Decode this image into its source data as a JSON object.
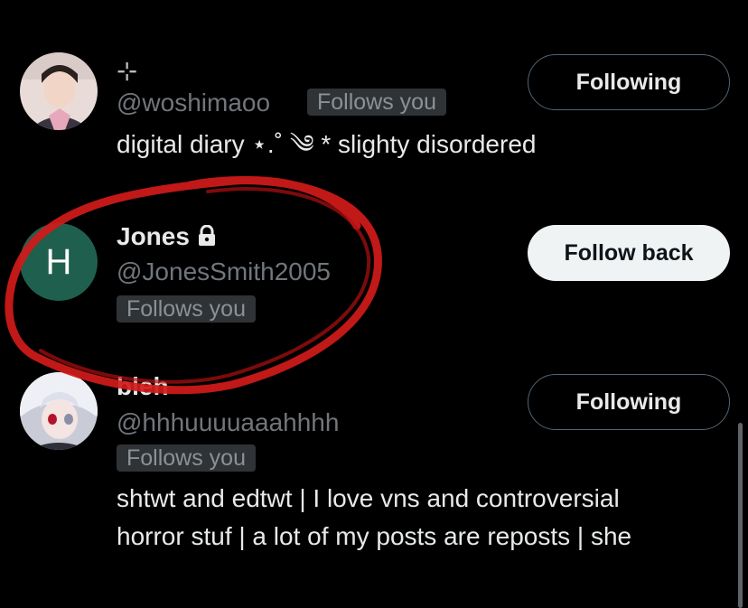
{
  "users": [
    {
      "name": "⊹",
      "handle": "@woshimaoo",
      "follows_you": "Follows you",
      "bio_lines": [
        "digital diary ⋆.˚ ༄ * slighty disordered"
      ],
      "button": "Following",
      "avatar": "photo-avatar"
    },
    {
      "name": "Jones",
      "handle": "@JonesSmith2005",
      "follows_you": "Follows you",
      "bio_lines": [],
      "button": "Follow back",
      "avatar_letter": "H",
      "avatar_color": "#1f5f4d",
      "locked": true
    },
    {
      "name": "bleh",
      "handle": "@hhhuuuuaaahhhh",
      "follows_you": "Follows you",
      "bio_lines": [
        "shtwt and edtwt | I love vns and controversial",
        "horror stuf | a lot of my posts are reposts | she"
      ],
      "button": "Following",
      "avatar": "anime-avatar"
    }
  ],
  "colors": {
    "background": "#000000",
    "handle": "#71767b",
    "badge_bg": "#2f3336",
    "annotation": "#d11a1a"
  }
}
